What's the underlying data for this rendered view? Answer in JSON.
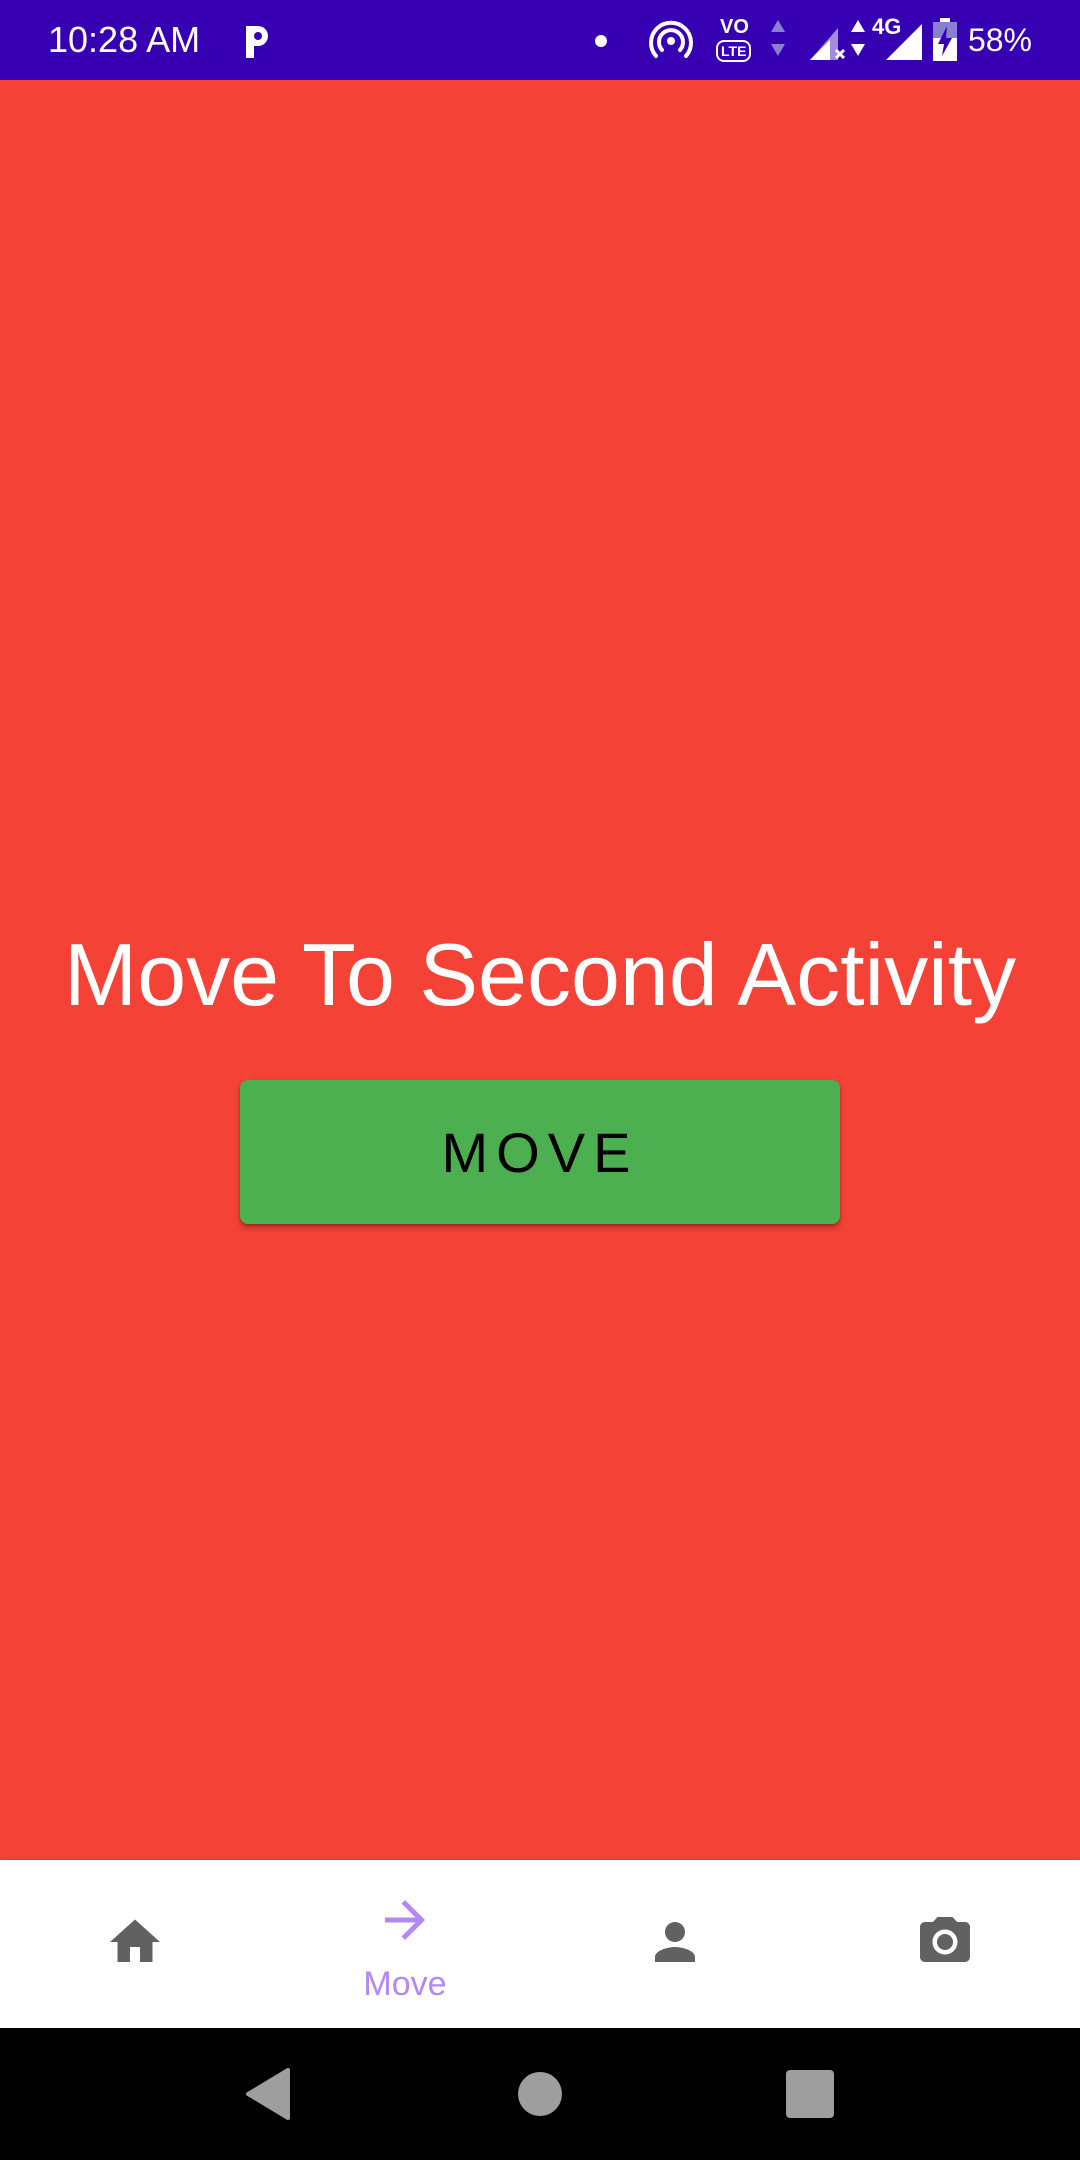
{
  "status_bar": {
    "time": "10:28 AM",
    "battery_percent": "58%",
    "icons": [
      "p-app-icon",
      "notification-dot-icon",
      "hotspot-icon",
      "volte-icon",
      "data-arrows-icon",
      "signal-no-service-icon",
      "network-4g-icon",
      "signal-icon",
      "battery-charging-icon"
    ],
    "volte_label": "VO",
    "lte_label": "LTE",
    "network_label": "4G"
  },
  "main": {
    "title": "Move To Second Activity",
    "button_label": "MOVE"
  },
  "bottom_nav": {
    "items": [
      {
        "icon": "home-icon",
        "label": "",
        "selected": false
      },
      {
        "icon": "arrow-forward-icon",
        "label": "Move",
        "selected": true
      },
      {
        "icon": "person-icon",
        "label": "",
        "selected": false
      },
      {
        "icon": "camera-icon",
        "label": "",
        "selected": false
      }
    ],
    "selected_color": "#B388F5",
    "unselected_color": "#616161"
  },
  "system_nav": {
    "buttons": [
      "back-icon",
      "home-circle-icon",
      "recents-icon"
    ]
  },
  "colors": {
    "status_bar": "#3700B3",
    "background": "#F44336",
    "button": "#4CAF50",
    "nav_background": "#FFFFFF",
    "system_nav": "#000000"
  }
}
